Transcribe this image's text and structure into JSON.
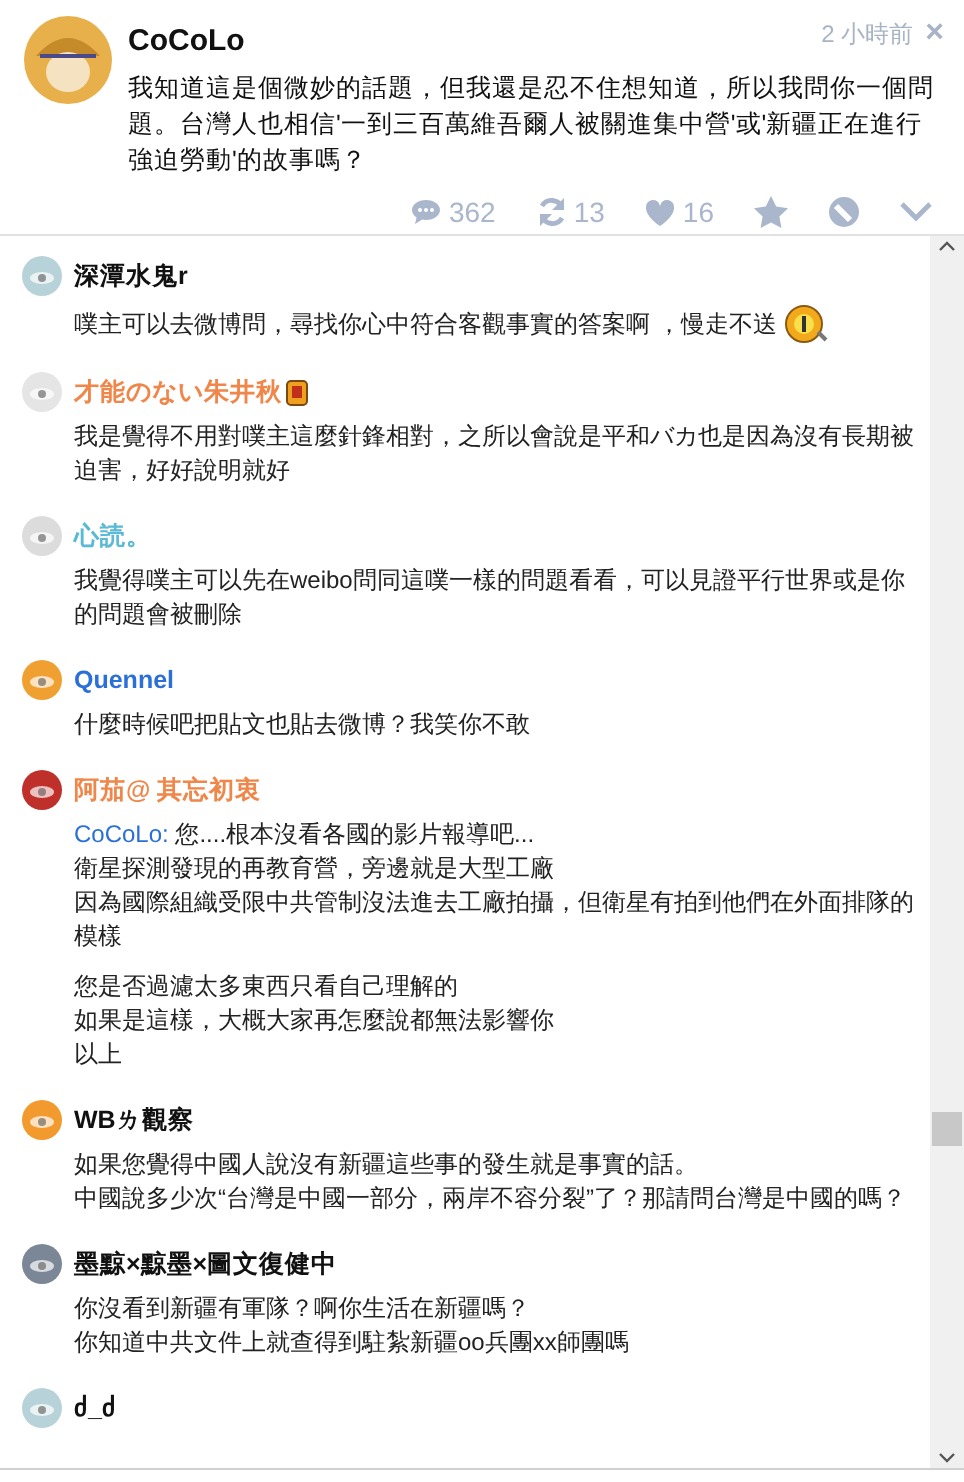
{
  "post": {
    "author": "CoCoLo",
    "time": "2 小時前",
    "close": "×",
    "text": "我知道這是個微妙的話題，但我還是忍不住想知道，所以我問你一個問題。台灣人也相信'一到三百萬維吾爾人被關進集中營'或'新疆正在進行強迫勞動'的故事嗎？",
    "stats": [
      {
        "kind": "comments",
        "label": "362"
      },
      {
        "kind": "replurks",
        "label": "13"
      },
      {
        "kind": "likes",
        "label": "16"
      },
      {
        "kind": "star"
      },
      {
        "kind": "mute"
      },
      {
        "kind": "more"
      }
    ]
  },
  "responses": [
    {
      "name": "深潭水鬼r",
      "color": "#111111",
      "paragraphs": [
        {
          "lines": [
            {
              "text": "噗主可以去微博問，尋找你心中符合客觀事實的答案啊 ，慢走不送"
            }
          ]
        }
      ],
      "emoticon": true
    },
    {
      "name": "才能のない朱井秋",
      "color": "#f0874a",
      "paragraphs": [
        {
          "lines": [
            {
              "text": "我是覺得不用對噗主這麼針鋒相對，之所以會說是平和バカ也是因為沒有長期被迫害，好好說明就好"
            }
          ]
        }
      ],
      "badge": true
    },
    {
      "name": "心読。",
      "color": "#5ab9d4",
      "paragraphs": [
        {
          "lines": [
            {
              "text": "我覺得噗主可以先在weibo問同這噗一樣的問題看看，可以見證平行世界或是你的問題會被刪除"
            }
          ]
        }
      ]
    },
    {
      "name": "Quennel",
      "color": "#2b6fd8",
      "paragraphs": [
        {
          "lines": [
            {
              "text": "什麼時候吧把貼文也貼去微博？我笑你不敢"
            }
          ]
        }
      ]
    },
    {
      "name": "阿茄@ 其忘初衷",
      "color": "#f0874a",
      "paragraphs": [
        {
          "lines": [
            {
              "mention": "CoCoLo:",
              "text": " 您....根本沒看各國的影片報導吧..."
            },
            {
              "text": "衛星探測發現的再教育營，旁邊就是大型工廠"
            },
            {
              "text": "因為國際組織受限中共管制沒法進去工廠拍攝，但衛星有拍到他們在外面排隊的模樣"
            }
          ]
        },
        {
          "lines": [
            {
              "text": "您是否過濾太多東西只看自己理解的"
            },
            {
              "text": "如果是這樣，大概大家再怎麼說都無法影響你"
            },
            {
              "text": "以上"
            }
          ]
        }
      ]
    },
    {
      "name": "WBㄌ觀察",
      "color": "#111111",
      "paragraphs": [
        {
          "lines": [
            {
              "text": "如果您覺得中國人說沒有新疆這些事的發生就是事實的話。"
            },
            {
              "text": "中國說多少次“台灣是中國一部分，兩岸不容分裂”了？那請問台灣是中國的嗎？"
            }
          ]
        }
      ]
    },
    {
      "name": "墨黥×黥墨×圖文復健中",
      "color": "#111111",
      "paragraphs": [
        {
          "lines": [
            {
              "text": "你沒看到新疆有軍隊？啊你生活在新疆嗎？"
            },
            {
              "text": "你知道中共文件上就查得到駐紮新疆oo兵團xx師團嗎"
            }
          ]
        }
      ]
    },
    {
      "name": "ძ_ძ",
      "color": "#111111"
    }
  ]
}
